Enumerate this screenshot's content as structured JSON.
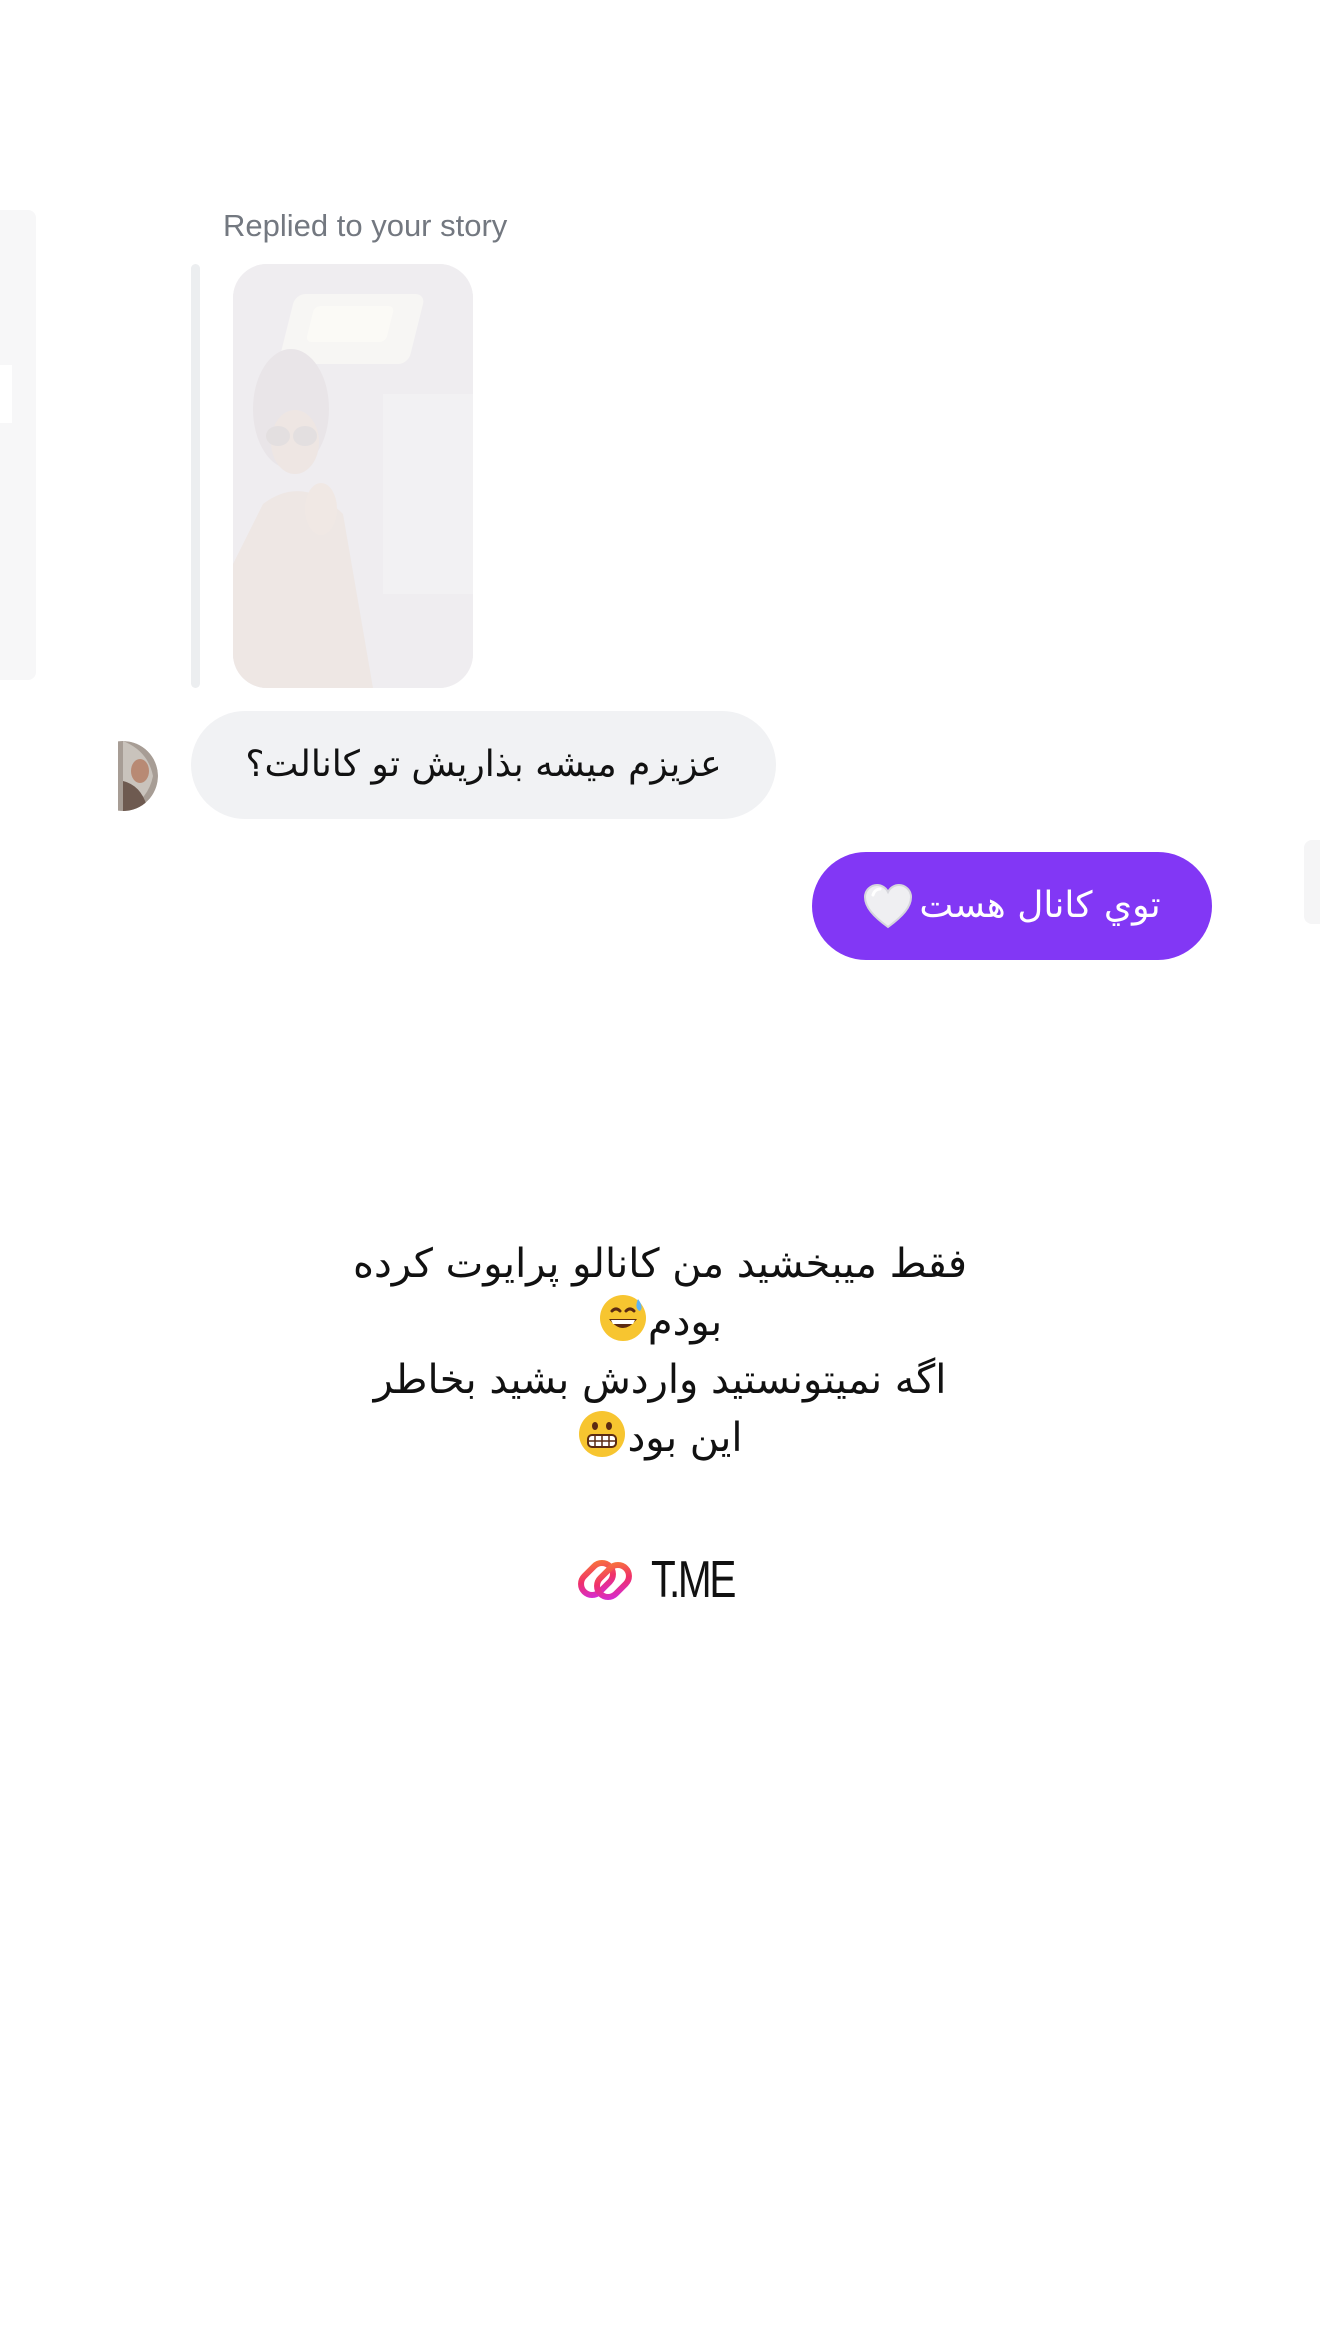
{
  "story_reply": {
    "caption": "Replied to your story"
  },
  "messages": [
    {
      "direction": "incoming",
      "text": "عزیزم میشه بذاریش تو کانالت؟"
    },
    {
      "direction": "outgoing",
      "text": "توي كانال هست",
      "emoji": "white-heart-icon"
    }
  ],
  "story_caption": {
    "line1": "فقط میبخشید من کانالو پرایوت کرده",
    "line2": "بودم",
    "line2_emoji": "grinning-sweat-emoji",
    "line3": "اگه نمیتونستید واردش بشید بخاطر",
    "line4": "این بود",
    "line4_emoji": "grimacing-emoji"
  },
  "link_sticker": {
    "label": "T.ME",
    "icon": "link-icon"
  },
  "colors": {
    "outgoing_bubble": "#8237f5",
    "incoming_bubble": "#f1f2f4",
    "caption_gray": "#737880"
  }
}
